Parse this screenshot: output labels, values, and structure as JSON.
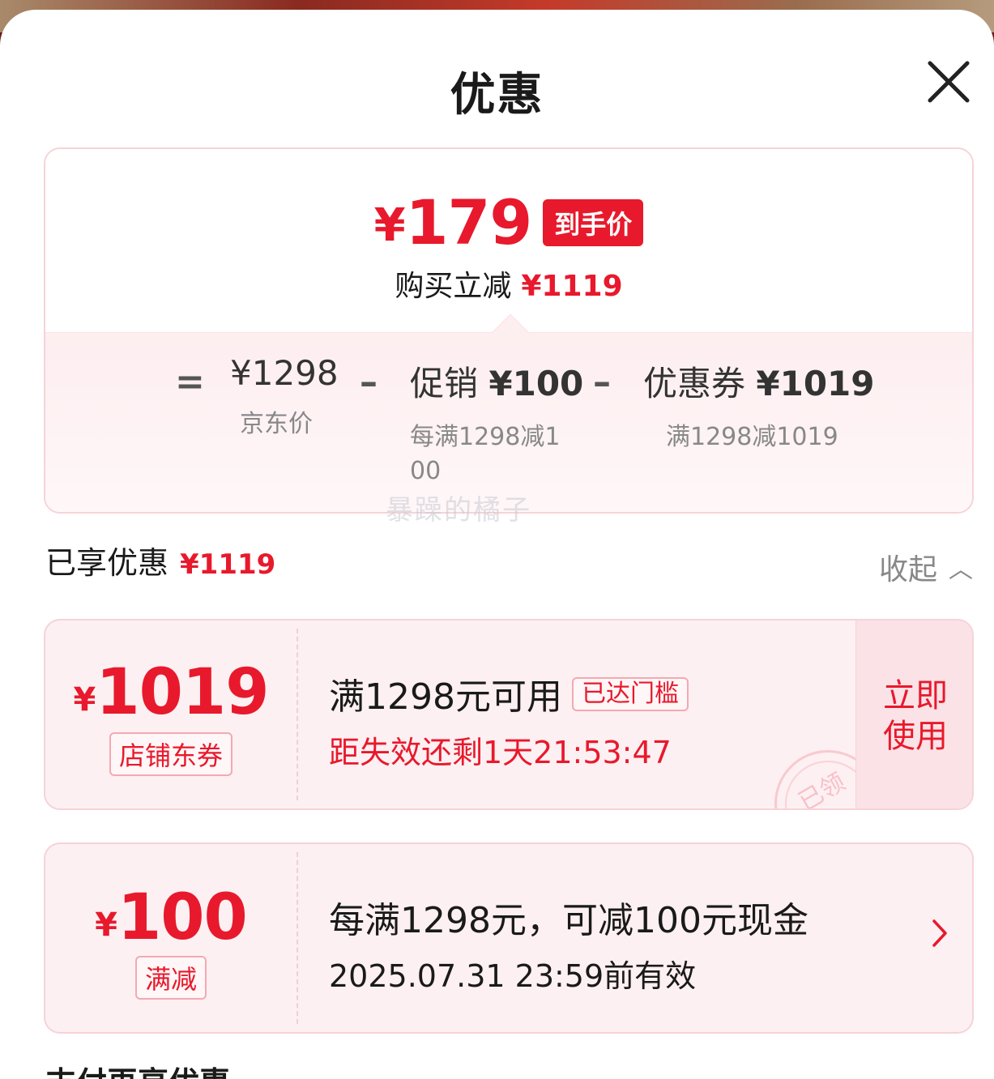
{
  "sheet": {
    "title": "优惠",
    "close_icon": "close-icon"
  },
  "summary": {
    "final_price_currency": "¥",
    "final_price": "179",
    "final_price_tag": "到手价",
    "save_label": "购买立减",
    "save_amount": "¥1119",
    "equals": "=",
    "minus": "–",
    "jd_price": "¥1298",
    "jd_price_label": "京东价",
    "promo_label": "促销",
    "promo_amount": "¥100",
    "promo_desc": "每满1298减100",
    "coupon_label": "优惠券",
    "coupon_amount": "¥1019",
    "coupon_desc": "满1298减1019",
    "watermark": "暴躁的橘子"
  },
  "enjoyed": {
    "label": "已享优惠",
    "amount": "¥1119",
    "collapse_label": "收起"
  },
  "coupons": [
    {
      "currency": "¥",
      "amount": "1019",
      "type_label": "店铺东券",
      "condition": "满1298元可用",
      "threshold_badge": "已达门槛",
      "expire_text": "距失效还剩1天21:53:47",
      "action_line1": "立即",
      "action_line2": "使用",
      "stamp_text": "已领"
    },
    {
      "currency": "¥",
      "amount": "100",
      "type_label": "满减",
      "condition": "每满1298元，可减100元现金",
      "valid_until": "2025.07.31 23:59前有效"
    }
  ],
  "more_section_title": "支付再享优惠",
  "colors": {
    "accent_red": "#e8192c",
    "card_pink": "#fdf0f2",
    "border_pink": "#f6d3d8"
  }
}
